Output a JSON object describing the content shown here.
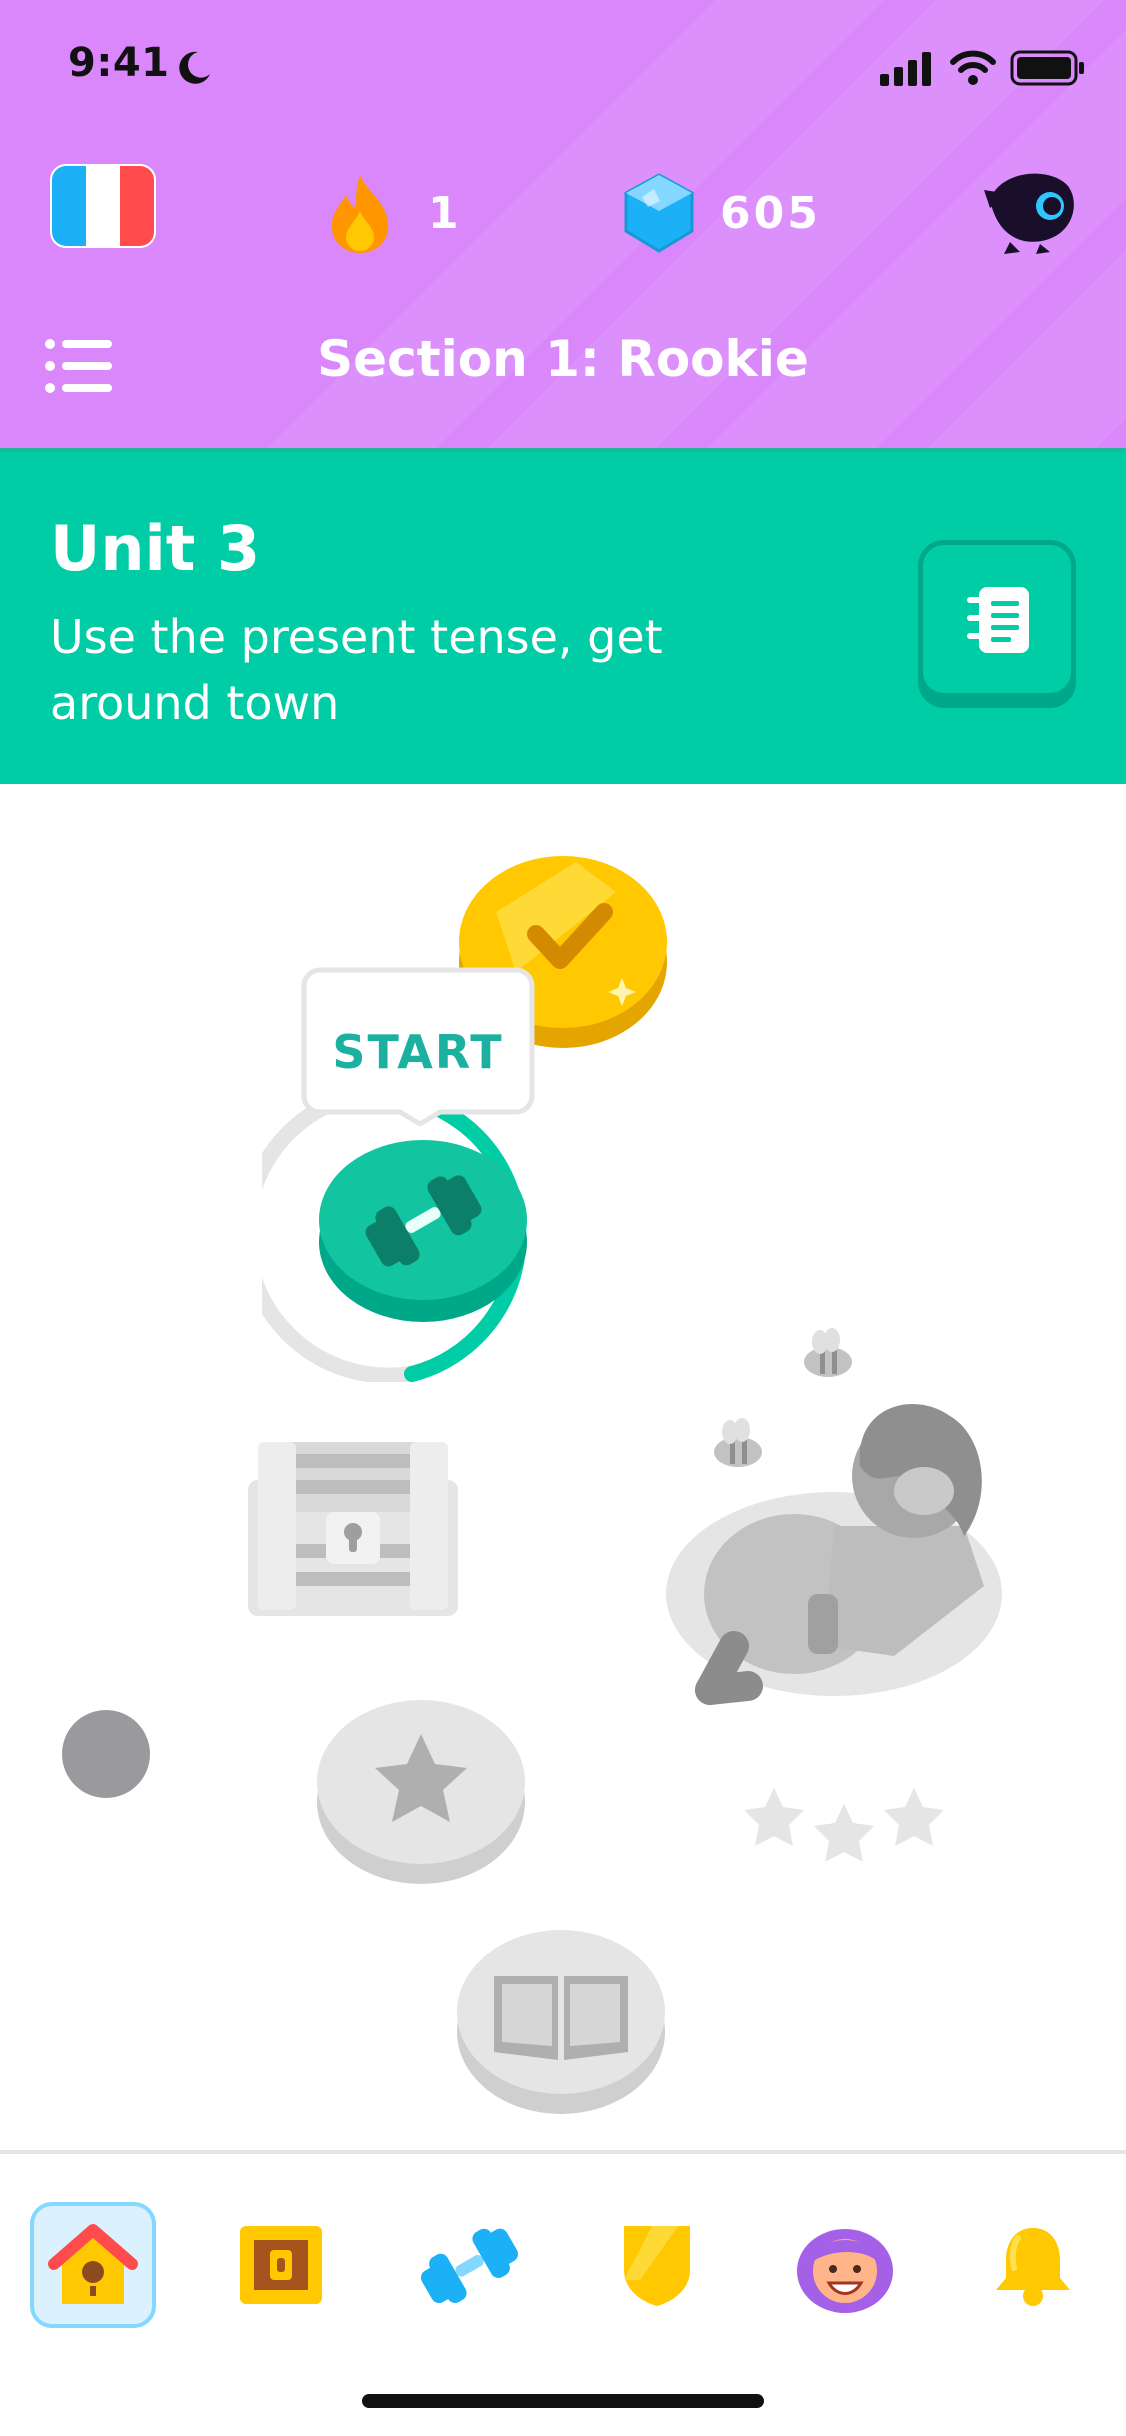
{
  "status_bar": {
    "time": "9:41"
  },
  "header": {
    "streak_count": "1",
    "gems_count": "605",
    "section_title": "Section 1: Rookie"
  },
  "unit": {
    "title": "Unit 3",
    "description": "Use the present tense, get around town"
  },
  "path": {
    "start_label": "START"
  },
  "icons": {
    "flag": "french-flag-icon",
    "streak": "flame-icon",
    "gems": "gem-icon",
    "profile": "mascot-avatar-icon",
    "menu": "list-icon",
    "guide": "notebook-icon",
    "tabs": [
      "home-icon",
      "chest-icon",
      "dumbbell-icon",
      "league-shield-icon",
      "profile-avatar-icon",
      "bell-icon"
    ]
  },
  "colors": {
    "header_bg": "#d987fb",
    "unit_bg": "#00cca6",
    "active_tab_bg": "#dbf1fd",
    "active_tab_border": "#84d8ff"
  }
}
